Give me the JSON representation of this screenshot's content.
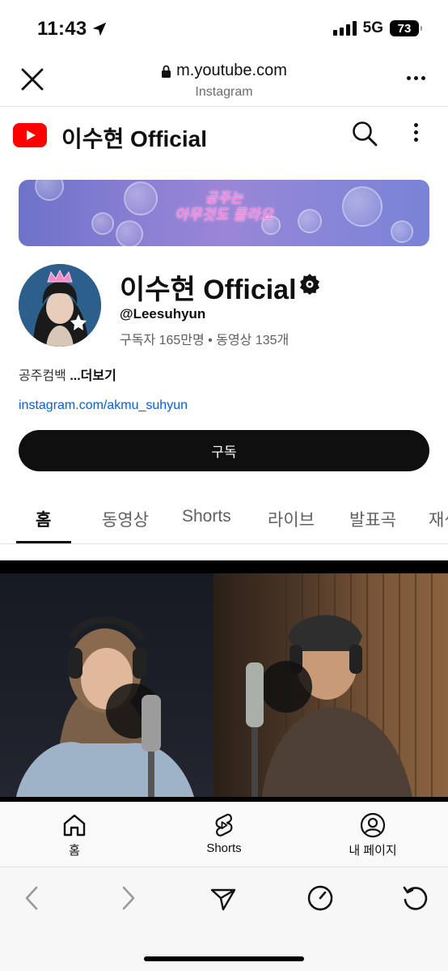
{
  "status_bar": {
    "time": "11:43",
    "network": "5G",
    "battery": "73"
  },
  "browser": {
    "url": "m.youtube.com",
    "source": "Instagram"
  },
  "yt_header": {
    "title": "이수현 Official"
  },
  "banner": {
    "line1": "공주는",
    "line2": "아무것도 몰라요"
  },
  "channel": {
    "name": "이수현 Official",
    "handle": "@Leesuhyun",
    "stats": "구독자 165만명 • 동영상 135개",
    "description": "공주컴백 ",
    "more_label": "...더보기",
    "link": "instagram.com/akmu_suhyun",
    "subscribe_label": "구독"
  },
  "tabs": [
    {
      "label": "홈",
      "active": true
    },
    {
      "label": "동영상"
    },
    {
      "label": "Shorts"
    },
    {
      "label": "라이브"
    },
    {
      "label": "발표곡"
    },
    {
      "label": "재생목록"
    }
  ],
  "bottom_nav": [
    {
      "label": "홈",
      "icon": "home-icon"
    },
    {
      "label": "Shorts",
      "icon": "shorts-icon"
    },
    {
      "label": "내 페이지",
      "icon": "profile-icon"
    }
  ],
  "toolbar_icons": [
    "back-icon",
    "forward-icon",
    "share-icon",
    "speed-icon",
    "reload-icon"
  ],
  "colors": {
    "youtube_red": "#ff0000",
    "link_blue": "#065fd4",
    "subscribe_bg": "#0f0f0f"
  }
}
